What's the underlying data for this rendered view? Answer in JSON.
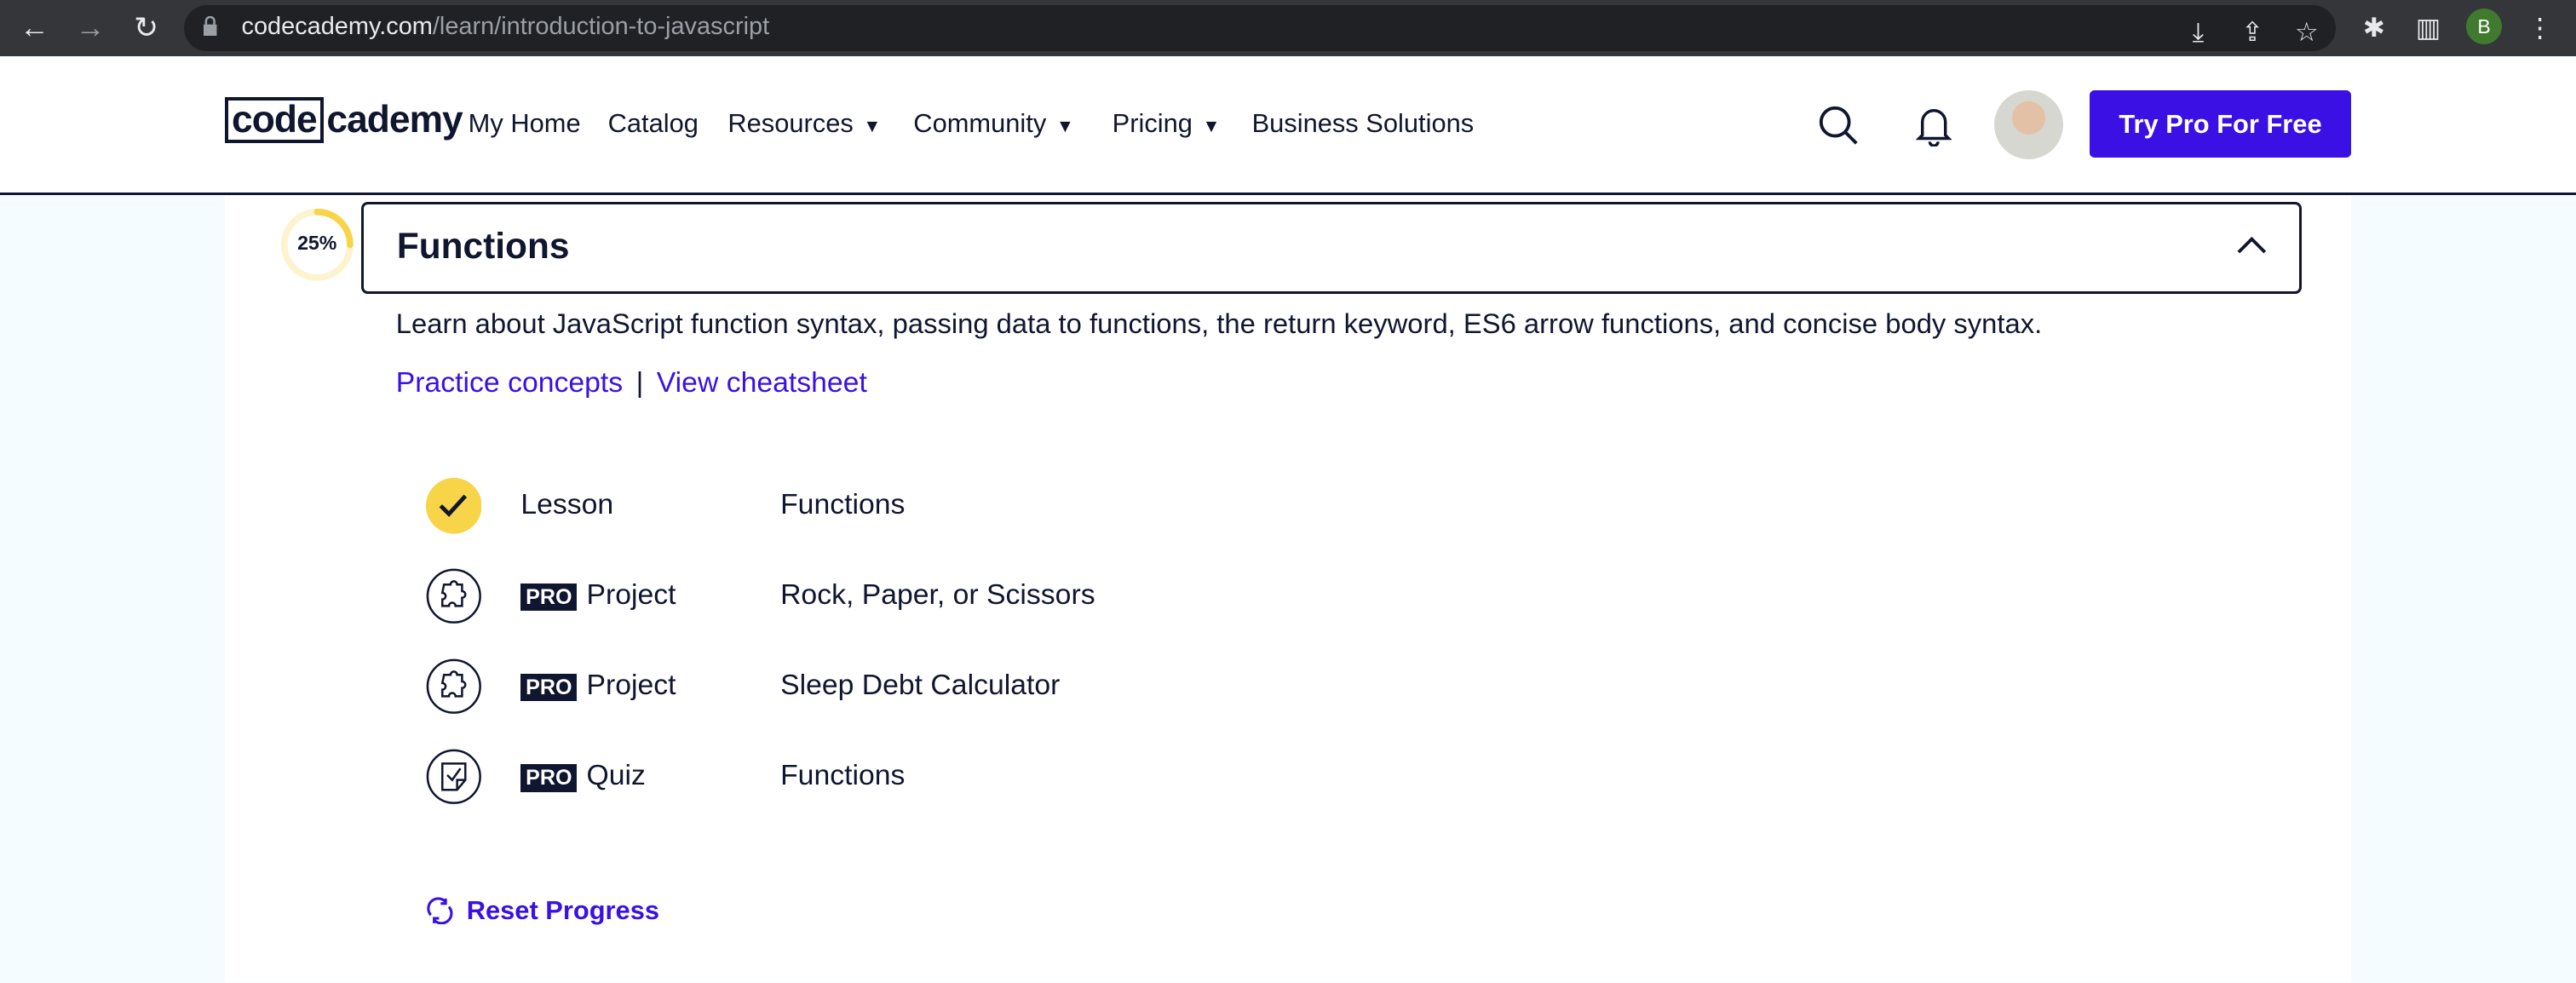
{
  "browser": {
    "url_host": "codecademy.com",
    "url_path": "/learn/introduction-to-javascript",
    "profile_initial": "B"
  },
  "nav": {
    "logo_box": "code",
    "logo_rest": "cademy",
    "items": [
      {
        "label": "My Home"
      },
      {
        "label": "Catalog"
      },
      {
        "label": "Resources",
        "dropdown": true
      },
      {
        "label": "Community",
        "dropdown": true
      },
      {
        "label": "Pricing",
        "dropdown": true
      },
      {
        "label": "Business Solutions"
      }
    ],
    "cta": "Try Pro For Free"
  },
  "module": {
    "progress_label": "25%",
    "progress": 0.25,
    "title": "Functions",
    "description": "Learn about JavaScript function syntax, passing data to functions, the return keyword, ES6 arrow functions, and concise body syntax.",
    "links": [
      "Practice concepts",
      "View cheatsheet"
    ],
    "separator": "|",
    "items": [
      {
        "icon": "check-icon",
        "pro": false,
        "type": "Lesson",
        "title": "Functions"
      },
      {
        "icon": "puzzle-icon",
        "pro": true,
        "pro_label": "PRO",
        "type": "Project",
        "title": "Rock, Paper, or Scissors"
      },
      {
        "icon": "puzzle-icon",
        "pro": true,
        "pro_label": "PRO",
        "type": "Project",
        "title": "Sleep Debt Calculator"
      },
      {
        "icon": "quiz-icon",
        "pro": true,
        "pro_label": "PRO",
        "type": "Quiz",
        "title": "Functions"
      }
    ],
    "reset": "Reset Progress"
  },
  "colors": {
    "accent": "#3a10e5",
    "navy": "#10162f",
    "yellow": "#f8d449"
  }
}
